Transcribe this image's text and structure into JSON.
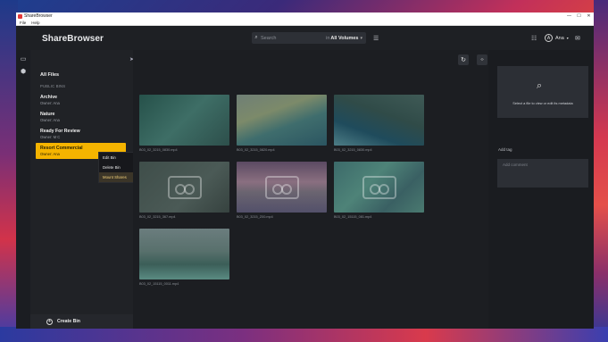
{
  "window": {
    "title": "ShareBrowser",
    "menu": [
      "File",
      "Help"
    ],
    "controls": [
      "—",
      "☐",
      "✕"
    ]
  },
  "app": {
    "brand": "ShareBrowser",
    "search": {
      "placeholder": "Search",
      "in_label": "in",
      "volume": "All Volumes"
    },
    "user": {
      "name": "Ana",
      "initial": "A"
    }
  },
  "sidebar": {
    "all_files": "All Files",
    "section": "PUBLIC BINS",
    "bins": [
      {
        "name": "Archive",
        "owner": "Owner: Ana"
      },
      {
        "name": "Nature",
        "owner": "Owner: Ana"
      },
      {
        "name": "Ready For Review",
        "owner": "Owner: M C"
      },
      {
        "name": "Resort Commercial",
        "owner": "Owner: Ana",
        "selected": true
      }
    ],
    "context_menu": [
      "Edit Bin",
      "Delete Bin",
      "Mount Shares"
    ],
    "context_highlight": "Mount Shares",
    "create_bin": "Create Bin"
  },
  "colors": {
    "accent": "#f5b400",
    "background": "#1b1d22"
  },
  "thumbnails": [
    {
      "label": "B03_02_3215_0830.mp4",
      "bg": "linear-gradient(135deg,#26514a,#3e6e66 50%,#2d4f4b)",
      "placeholder": false
    },
    {
      "label": "B03_02_3215_0820.mp4",
      "bg": "linear-gradient(160deg,#6f7f76 0%,#7c8a6a 35%,#3f6d6d 60%,#2b5561 100%)",
      "placeholder": false
    },
    {
      "label": "B03_02_3215_0830.mp4",
      "bg": "linear-gradient(200deg,#3f5a56 0%,#304b48 40%,#1f4b5c 70%,#4d7d86 100%)",
      "placeholder": false
    },
    {
      "label": "B03_02_3215_367.mp4",
      "bg": "linear-gradient(135deg,#3f4e4a,#4b5a56 60%,#36423f)",
      "placeholder": true
    },
    {
      "label": "B03_02_3215_Z00.mp4",
      "bg": "linear-gradient(180deg,#5b4a62 0%,#8a6f80 40%,#6a6470 60%,#53506a 100%)",
      "placeholder": true
    },
    {
      "label": "B03_02_15115_081.mp4",
      "bg": "linear-gradient(135deg,#3c6a6a,#4e8378 40%,#3a6063 70%,#4a7a70)",
      "placeholder": true
    },
    {
      "label": "B03_02_15115_0011.mp4",
      "bg": "linear-gradient(180deg,#6b7d7e 0%,#58706c 45%,#3b5e58 70%,#5a8b82 100%)",
      "placeholder": false
    }
  ],
  "right_panel": {
    "empty_text": "Select a file to view or edit its metadata",
    "add_tag": "Add tag",
    "comment_placeholder": "Add comment"
  }
}
